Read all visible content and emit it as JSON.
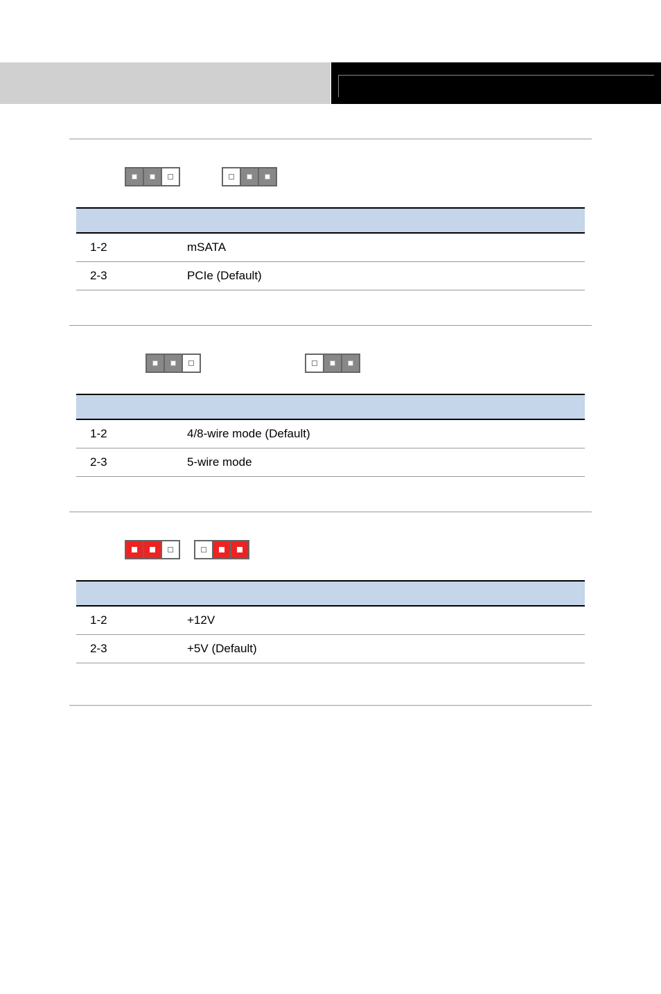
{
  "sections": [
    {
      "id": "jp1",
      "jumper_layout": "normal",
      "jumpers": [
        {
          "pins": [
            "filled",
            "filled",
            "white"
          ],
          "color": "gray"
        },
        {
          "pins": [
            "white",
            "filled",
            "filled"
          ],
          "color": "gray"
        }
      ],
      "rows": [
        {
          "col1": "1-2",
          "col2": "mSATA"
        },
        {
          "col1": "2-3",
          "col2": "PCIe (Default)"
        }
      ]
    },
    {
      "id": "jp2",
      "jumper_layout": "wide",
      "jumpers": [
        {
          "pins": [
            "filled",
            "filled",
            "white"
          ],
          "color": "gray"
        },
        {
          "pins": [
            "white",
            "filled",
            "filled"
          ],
          "color": "gray"
        }
      ],
      "rows": [
        {
          "col1": "1-2",
          "col2": "4/8-wire mode (Default)"
        },
        {
          "col1": "2-3",
          "col2": "5-wire mode"
        }
      ]
    },
    {
      "id": "jp3",
      "jumper_layout": "narrow",
      "jumpers": [
        {
          "pins": [
            "filled",
            "filled",
            "white"
          ],
          "color": "red"
        },
        {
          "pins": [
            "white",
            "filled",
            "filled"
          ],
          "color": "red"
        }
      ],
      "rows": [
        {
          "col1": "1-2",
          "col2": "+12V"
        },
        {
          "col1": "2-3",
          "col2": "+5V (Default)"
        }
      ]
    }
  ]
}
